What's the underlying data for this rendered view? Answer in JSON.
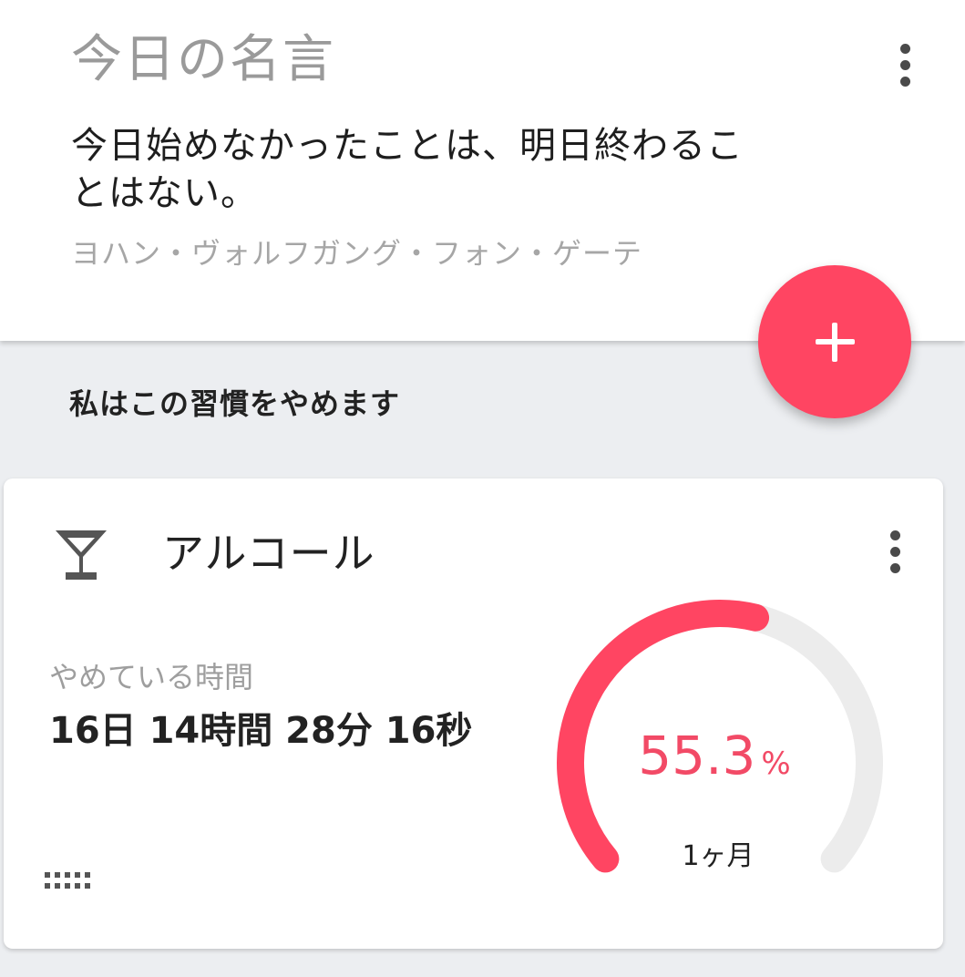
{
  "quote": {
    "title": "今日の名言",
    "text": "今日始めなかったことは、明日終わることはない。",
    "author": "ヨハン・ヴォルフガング・フォン・ゲーテ",
    "menu_icon": "more-vert-icon"
  },
  "fab": {
    "icon": "plus-icon",
    "color": "#ff4562"
  },
  "section": {
    "heading": "私はこの習慣をやめます"
  },
  "habit": {
    "icon": "cocktail-icon",
    "name": "アルコール",
    "menu_icon": "more-vert-icon",
    "elapsed_label": "やめている時間",
    "elapsed_value": "16日 14時間 28分 16秒",
    "progress_fraction": 0.553,
    "progress_text": "55.3",
    "progress_unit": "%",
    "goal_label": "1ヶ月",
    "drag_icon": "drag-handle-icon",
    "colors": {
      "progress": "#ff4562",
      "track": "#ececec",
      "percent_text": "#f24a66"
    }
  }
}
